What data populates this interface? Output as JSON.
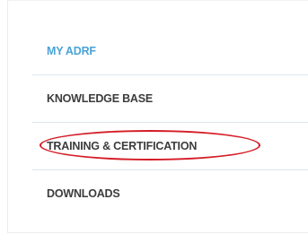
{
  "menu": {
    "items": [
      {
        "label": "MY ADRF",
        "active": true
      },
      {
        "label": "KNOWLEDGE BASE",
        "active": false
      },
      {
        "label": "TRAINING & CERTIFICATION",
        "active": false,
        "highlighted": true
      },
      {
        "label": "DOWNLOADS",
        "active": false
      }
    ]
  },
  "colors": {
    "active_text": "#4aa3d7",
    "text": "#3c3c3c",
    "divider": "#dbe6ee",
    "highlight": "#d51c26"
  }
}
